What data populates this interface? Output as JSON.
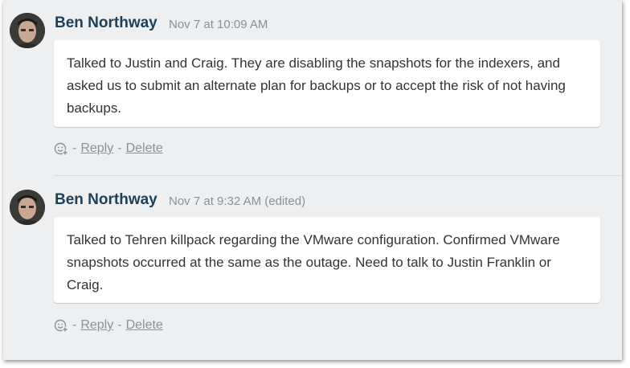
{
  "comments": [
    {
      "author": "Ben Northway",
      "meta": "Nov 7 at 10:09 AM",
      "body": "Talked to Justin and Craig. They are disabling the snapshots for the indexers, and asked us to submit an alternate plan for backups or to accept the risk of not having backups.",
      "actions": {
        "sep": "-",
        "reply": "Reply",
        "delete": "Delete"
      }
    },
    {
      "author": "Ben Northway",
      "meta": "Nov 7 at 9:32 AM (edited)",
      "body": "Talked to Tehren killpack regarding the VMware configuration. Confirmed VMware snapshots occurred at the same as the outage. Need to talk to Justin Franklin or Craig.",
      "actions": {
        "sep": "-",
        "reply": "Reply",
        "delete": "Delete"
      }
    }
  ],
  "colors": {
    "background": "#edeff0",
    "author": "#1e4159",
    "meta": "#8a9196",
    "body_text": "#333333"
  },
  "icons": {
    "avatar": "user-avatar-photo",
    "reaction": "add-reaction-emoji-icon"
  }
}
